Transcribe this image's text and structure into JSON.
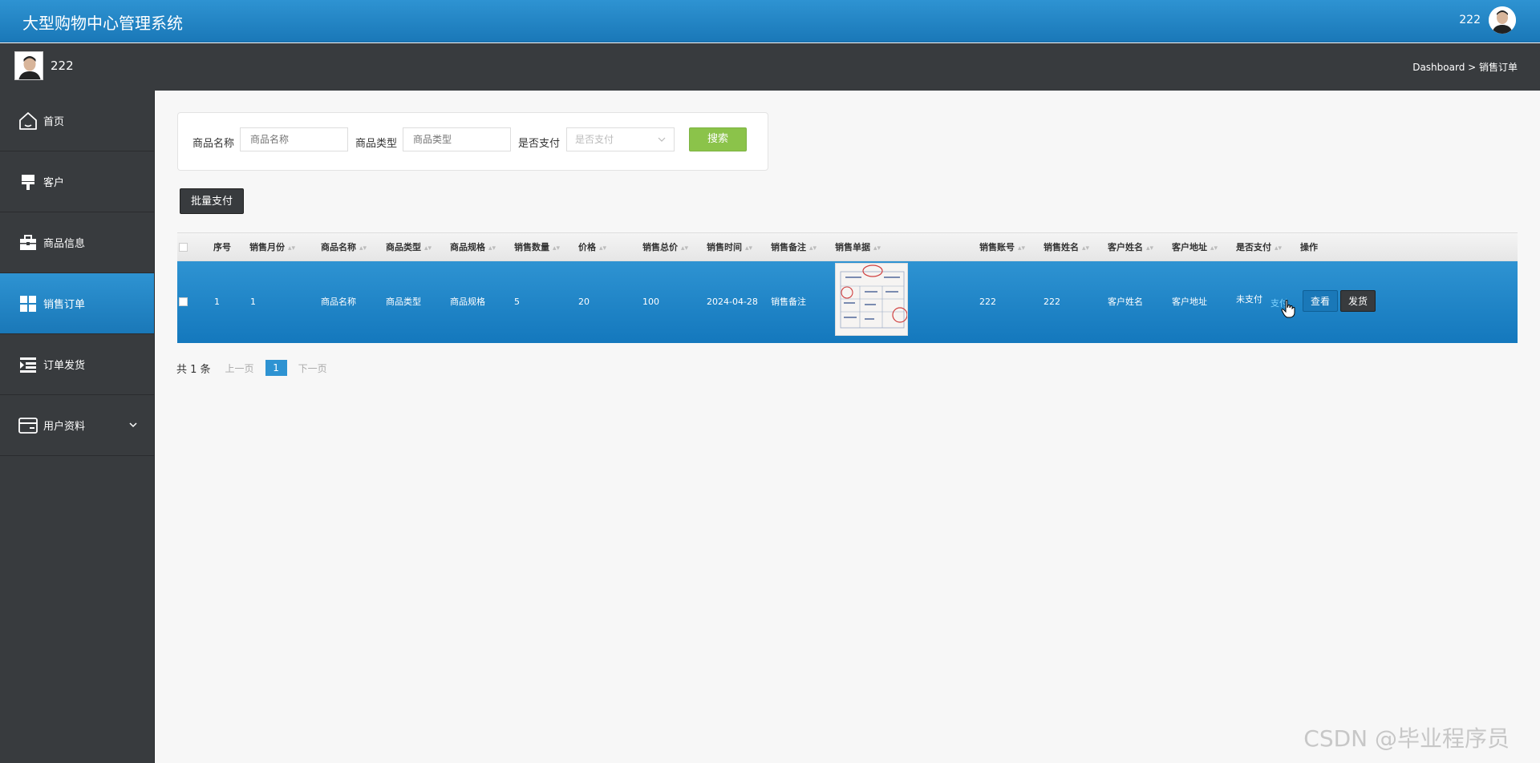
{
  "app": {
    "title": "大型购物中心管理系统"
  },
  "top_user": {
    "name": "222"
  },
  "sub_user": {
    "name": "222"
  },
  "breadcrumb": {
    "text": "Dashboard > 销售订单"
  },
  "sidebar": {
    "items": [
      {
        "label": "首页",
        "icon": "home-icon"
      },
      {
        "label": "客户",
        "icon": "paint-brush-icon"
      },
      {
        "label": "商品信息",
        "icon": "briefcase-icon"
      },
      {
        "label": "销售订单",
        "icon": "grid-icon",
        "active": true
      },
      {
        "label": "订单发货",
        "icon": "indent-list-icon"
      },
      {
        "label": "用户资料",
        "icon": "card-icon",
        "expandable": true
      }
    ]
  },
  "search": {
    "name_label": "商品名称",
    "name_placeholder": "商品名称",
    "type_label": "商品类型",
    "type_placeholder": "商品类型",
    "paid_label": "是否支付",
    "paid_select_value": "是否支付",
    "button": "搜索"
  },
  "toolbar": {
    "batch_pay": "批量支付"
  },
  "table": {
    "columns": [
      "序号",
      "销售月份",
      "商品名称",
      "商品类型",
      "商品规格",
      "销售数量",
      "价格",
      "销售总价",
      "销售时间",
      "销售备注",
      "销售单据",
      "销售账号",
      "销售姓名",
      "客户姓名",
      "客户地址",
      "是否支付",
      "操作"
    ],
    "rows": [
      {
        "index": "1",
        "month": "1",
        "name": "商品名称",
        "type": "商品类型",
        "spec": "商品规格",
        "quantity": "5",
        "price": "20",
        "total": "100",
        "time": "2024-04-28",
        "remark": "销售备注",
        "account": "222",
        "seller": "222",
        "customer": "客户姓名",
        "address": "客户地址",
        "paid": "未支付",
        "pay_link": "支付",
        "view": "查看",
        "ship": "发货"
      }
    ]
  },
  "pager": {
    "total": "共 1 条",
    "prev": "上一页",
    "current": "1",
    "next": "下一页"
  },
  "watermark": "CSDN @毕业程序员",
  "colors": {
    "primary": "#2e93d2",
    "dark": "#383b3e",
    "search_green": "#8bc34a"
  }
}
